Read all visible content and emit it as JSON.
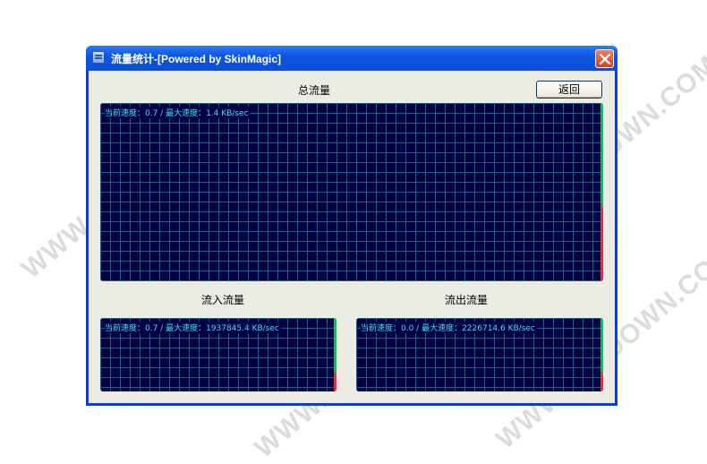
{
  "watermark": {
    "text": "WWW.WEIDOWN.COM"
  },
  "window": {
    "title": "流量统计-[Powered by SkinMagic]"
  },
  "toolbar": {
    "back_label": "返回"
  },
  "graphs": {
    "total": {
      "title": "总流量",
      "status": "当前速度：0.7 / 最大速度：1.4 KB/sec"
    },
    "in": {
      "title": "流入流量",
      "status": "当前速度：0.7 / 最大速度：1937845.4 KB/sec"
    },
    "out": {
      "title": "流出流量",
      "status": "当前速度：0.0 / 最大速度：2226714.6 KB/sec"
    }
  },
  "colors": {
    "graph_bg": "#000044",
    "grid": "#0c6a7a",
    "text": "#33e6f0",
    "level_low": "#00c060",
    "level_high": "#ff2040"
  }
}
